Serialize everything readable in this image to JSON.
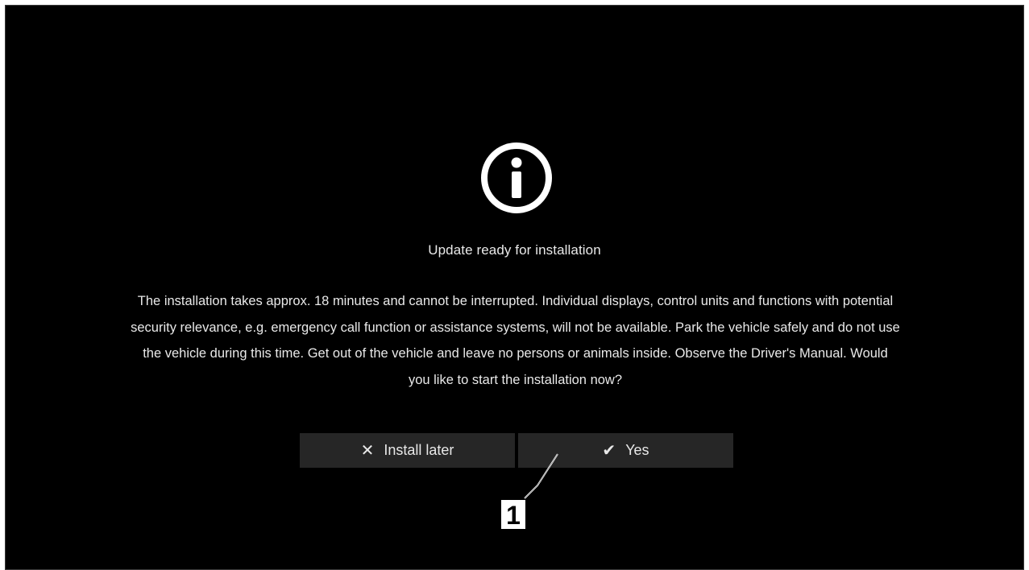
{
  "dialog": {
    "icon": "info-circle-icon",
    "title": "Update ready for installation",
    "message": "The installation takes approx. 18 minutes and cannot be interrupted. Individual displays, control units and functions with potential security relevance, e.g. emergency call function or assistance systems, will not be available. Park the vehicle safely and do not use the vehicle during this time. Get out of the vehicle and leave no persons or animals inside. Observe the Driver's Manual. Would you like to start the installation now?",
    "buttons": {
      "later": {
        "icon": "close-x-icon",
        "label": "Install later"
      },
      "yes": {
        "icon": "checkmark-icon",
        "label": "Yes"
      }
    }
  },
  "callout": {
    "number": "1"
  },
  "colors": {
    "background": "#000000",
    "text": "#e9e9e9",
    "button": "#262626",
    "frame": "#ffffff"
  }
}
